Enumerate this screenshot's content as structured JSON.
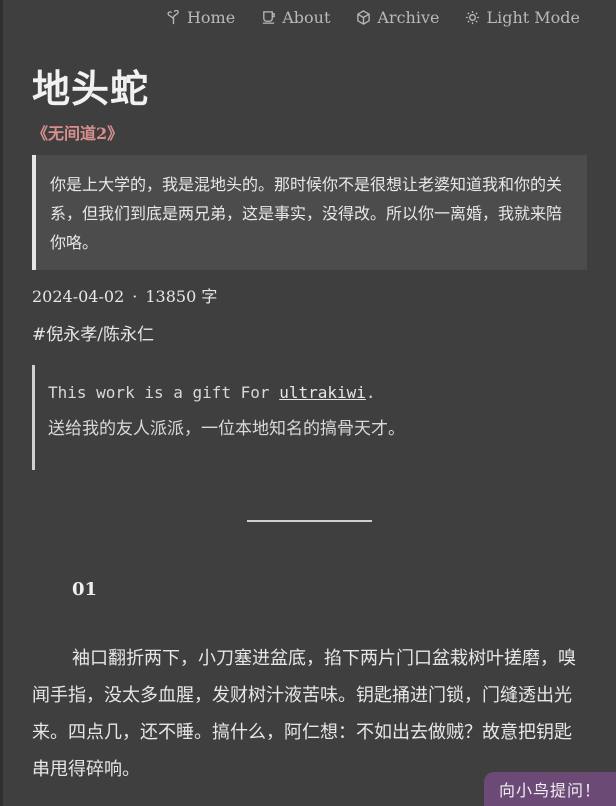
{
  "nav": {
    "items": [
      {
        "label": "Home",
        "icon": "tree-icon"
      },
      {
        "label": "About",
        "icon": "cup-icon"
      },
      {
        "label": "Archive",
        "icon": "box-icon"
      },
      {
        "label": "Light Mode",
        "icon": "sun-icon"
      }
    ]
  },
  "post": {
    "title": "地头蛇",
    "subtitle": "《无间道2》",
    "quote": "你是上大学的，我是混地头的。那时候你不是很想让老婆知道我和你的关系，但我们到底是两兄弟，这是事实，没得改。所以你一离婚，我就来陪你咯。",
    "date": "2024-04-02",
    "separator": "·",
    "word_count": "13850 字",
    "tag": "#倪永孝/陈永仁",
    "gift_prefix": "This work is a gift For ",
    "gift_user": "ultrakiwi",
    "gift_suffix": ".",
    "gift_note": "送给我的友人派派，一位本地知名的搞骨天才。",
    "section_number": "01",
    "paragraph": "袖口翻折两下，小刀塞进盆底，掐下两片门口盆栽树叶搓磨，嗅闻手指，没太多血腥，发财树汁液苦味。钥匙捅进门锁，门缝透出光来。四点几，还不睡。搞什么，阿仁想：不如出去做贼？故意把钥匙串甩得碎响。"
  },
  "ask_button": "向小鸟提问！"
}
